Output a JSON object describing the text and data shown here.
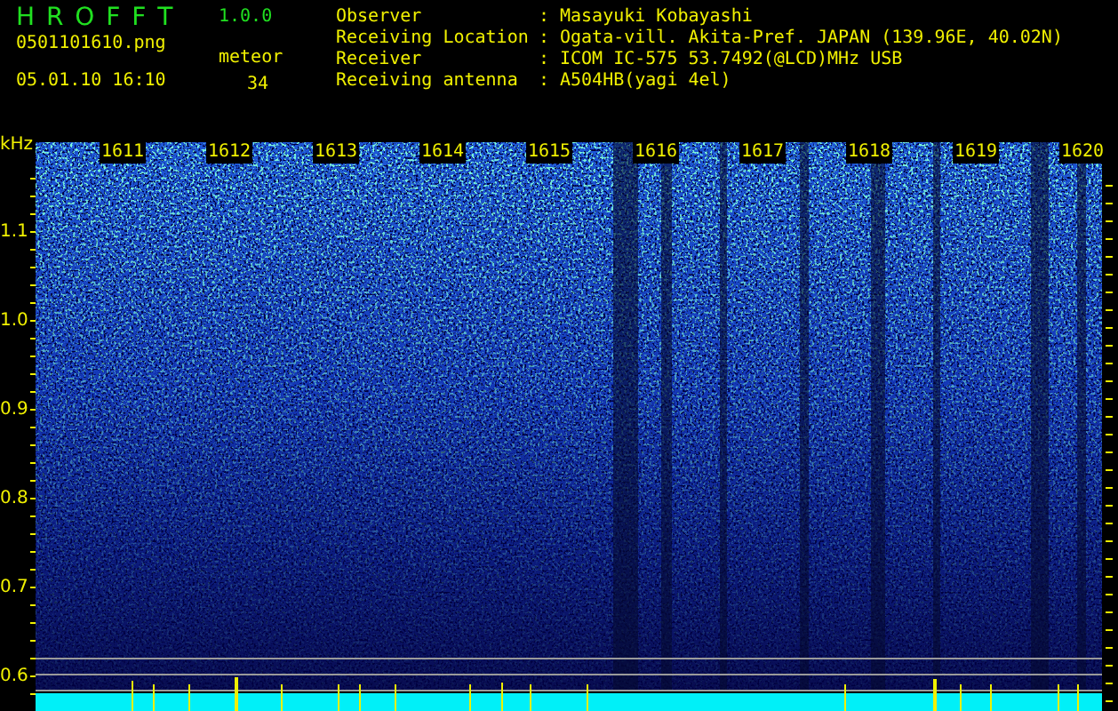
{
  "header": {
    "title": "H R O F F T",
    "version": "1.0.0",
    "filename": "0501101610.png",
    "datetime": "05.01.10 16:10",
    "count_label": "meteor",
    "count": "34"
  },
  "station": [
    {
      "label": "Observer",
      "separator": ":",
      "value": "Masayuki Kobayashi"
    },
    {
      "label": "Receiving Location",
      "separator": ":",
      "value": "Ogata-vill. Akita-Pref. JAPAN (139.96E, 40.02N)"
    },
    {
      "label": "Receiver",
      "separator": ":",
      "value": "ICOM IC-575 53.7492(@LCD)MHz USB"
    },
    {
      "label": "Receiving antenna",
      "separator": ":",
      "value": "A504HB(yagi 4el)"
    }
  ],
  "spectrogram": {
    "y_unit": "kHz",
    "y_labels": [
      "1.1",
      "1.0",
      "0.9",
      "0.8",
      "0.7",
      "0.6"
    ],
    "time_labels": [
      "1611",
      "1612",
      "1613",
      "1614",
      "1615",
      "1616",
      "1617",
      "1618",
      "1619",
      "1620"
    ]
  }
}
